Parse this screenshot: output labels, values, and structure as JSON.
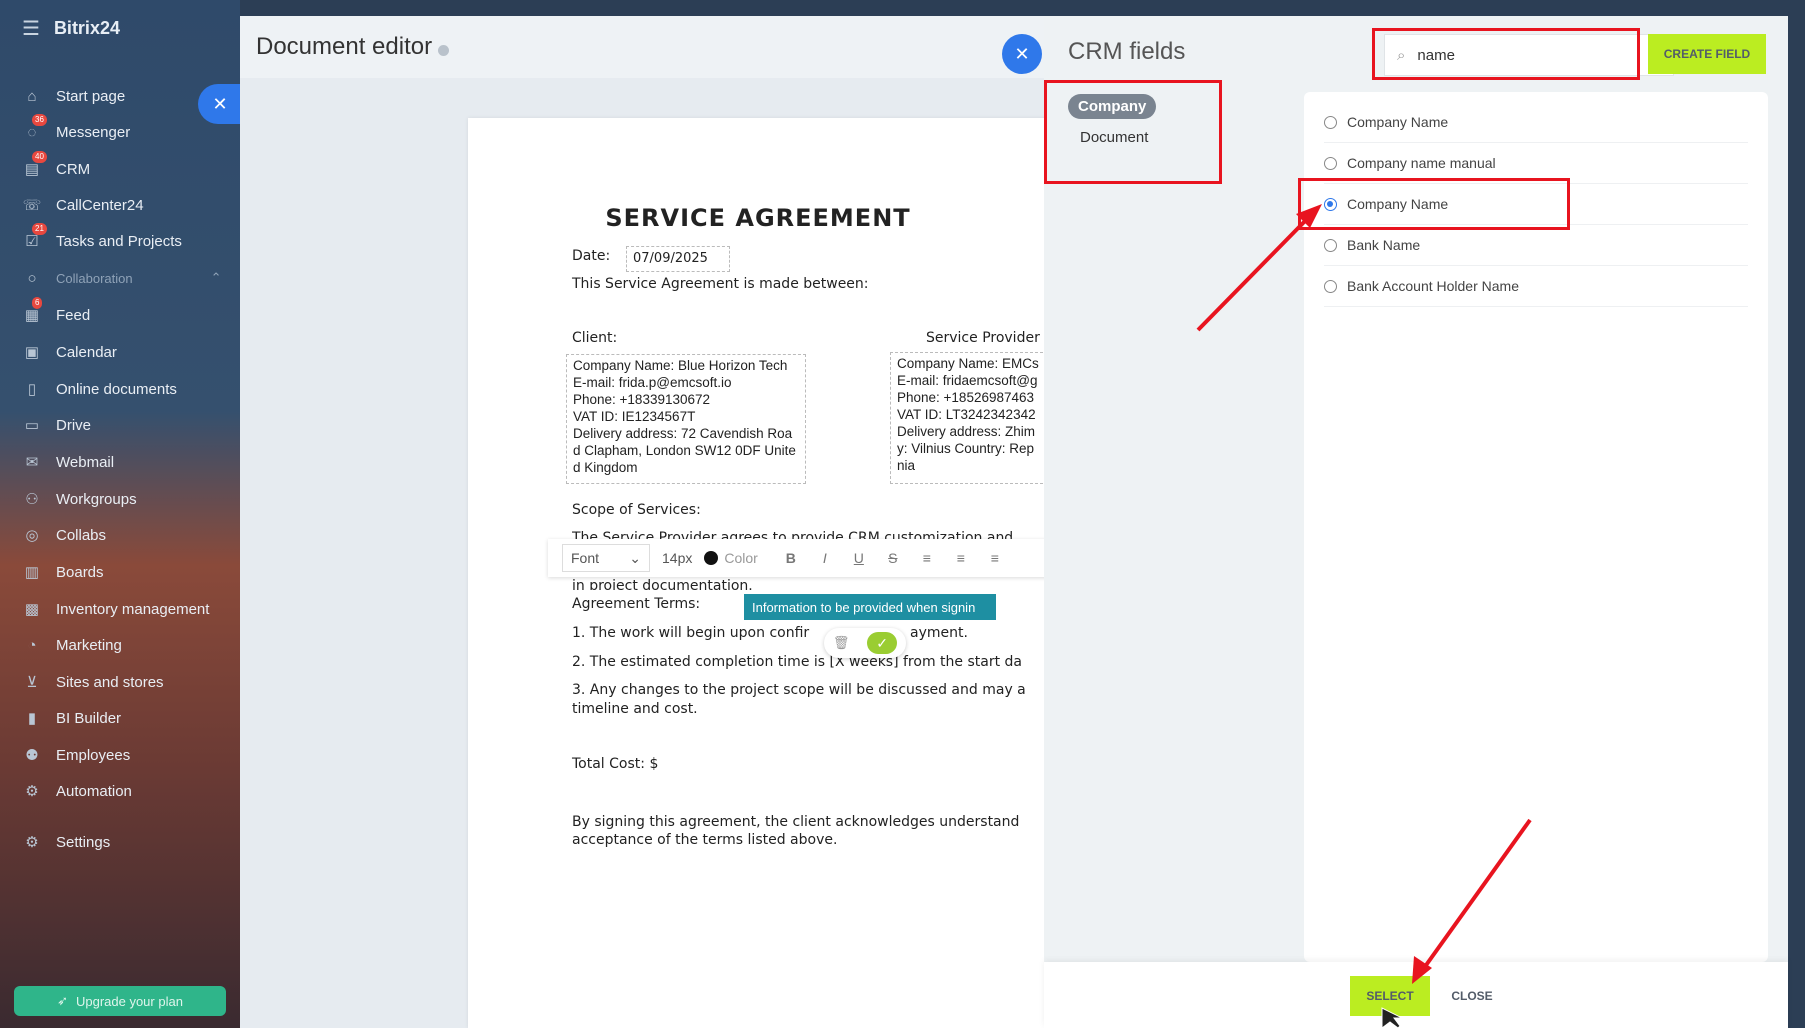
{
  "sidebar": {
    "logo": "Bitrix24",
    "items": [
      {
        "label": "Start page"
      },
      {
        "label": "Messenger",
        "badge": "36"
      },
      {
        "label": "CRM",
        "badge": "40"
      },
      {
        "label": "CallCenter24"
      },
      {
        "label": "Tasks and Projects",
        "badge": "21"
      },
      {
        "label": "Collaboration"
      },
      {
        "label": "Feed",
        "badge": "6"
      },
      {
        "label": "Calendar"
      },
      {
        "label": "Online documents"
      },
      {
        "label": "Drive"
      },
      {
        "label": "Webmail"
      },
      {
        "label": "Workgroups"
      },
      {
        "label": "Collabs"
      },
      {
        "label": "Boards"
      },
      {
        "label": "Inventory management"
      },
      {
        "label": "Marketing"
      },
      {
        "label": "Sites and stores"
      },
      {
        "label": "BI Builder"
      },
      {
        "label": "Employees"
      },
      {
        "label": "Automation"
      },
      {
        "label": "Settings"
      }
    ],
    "upgrade_label": "Upgrade your plan"
  },
  "editor": {
    "title": "Document editor",
    "doc": {
      "heading": "SERVICE AGREEMENT",
      "date_label": "Date:",
      "date_value": "07/09/2025",
      "intro": "This Service Agreement is made between:",
      "client_label": "Client:",
      "provider_label": "Service Provider",
      "client_block": "Company Name: Blue Horizon Tech\nE-mail: frida.p@emcsoft.io\nPhone: +18339130672\nVAT ID: IE1234567T\nDelivery address: 72 Cavendish Roa\nd Clapham, London SW12 0DF Unite\nd Kingdom",
      "provider_block": "Company Name: EMCs\nE-mail: fridaemcsoft@g\nPhone: +18526987463\nVAT ID: LT3242342342\nDelivery address: Zhim\ny: Vilnius Country: Rep\nnia",
      "scope_label": "Scope of Services:",
      "scope_partial": "The Service Provider agrees to provide CRM customization and",
      "scope_partial2": "in project documentation.",
      "terms_label": "Agreement Terms:",
      "term1a": "1. The work will begin upon confir",
      "term1b": "ayment.",
      "term2": "2. The estimated completion time is [X weeks] from the start da",
      "term3a": "3. Any changes to the project scope will be discussed and may a",
      "term3b": "timeline and cost.",
      "total": "Total Cost: $",
      "closing_a": "By signing this agreement, the client acknowledges understand",
      "closing_b": "acceptance of the terms listed above."
    },
    "toolbar": {
      "font_label": "Font",
      "size": "14px",
      "color_label": "Color",
      "bold": "B",
      "italic": "I",
      "underline": "U",
      "strike": "S"
    },
    "field_tag": "Information to be provided when signin"
  },
  "crm": {
    "title": "CRM fields",
    "search_value": "name",
    "create_label": "CREATE FIELD",
    "categories": [
      "Company",
      "Document"
    ],
    "fields": [
      {
        "label": "Company Name",
        "selected": false
      },
      {
        "label": "Company name manual",
        "selected": false
      },
      {
        "label": "Company Name",
        "selected": true
      },
      {
        "label": "Bank Name",
        "selected": false
      },
      {
        "label": "Bank Account Holder Name",
        "selected": false
      }
    ],
    "select_label": "SELECT",
    "close_label": "CLOSE"
  },
  "colors": {
    "accent": "#2f78ea",
    "create_button": "#bbed21",
    "annotation": "#e8141f",
    "field_tag": "#1e8fa2"
  }
}
